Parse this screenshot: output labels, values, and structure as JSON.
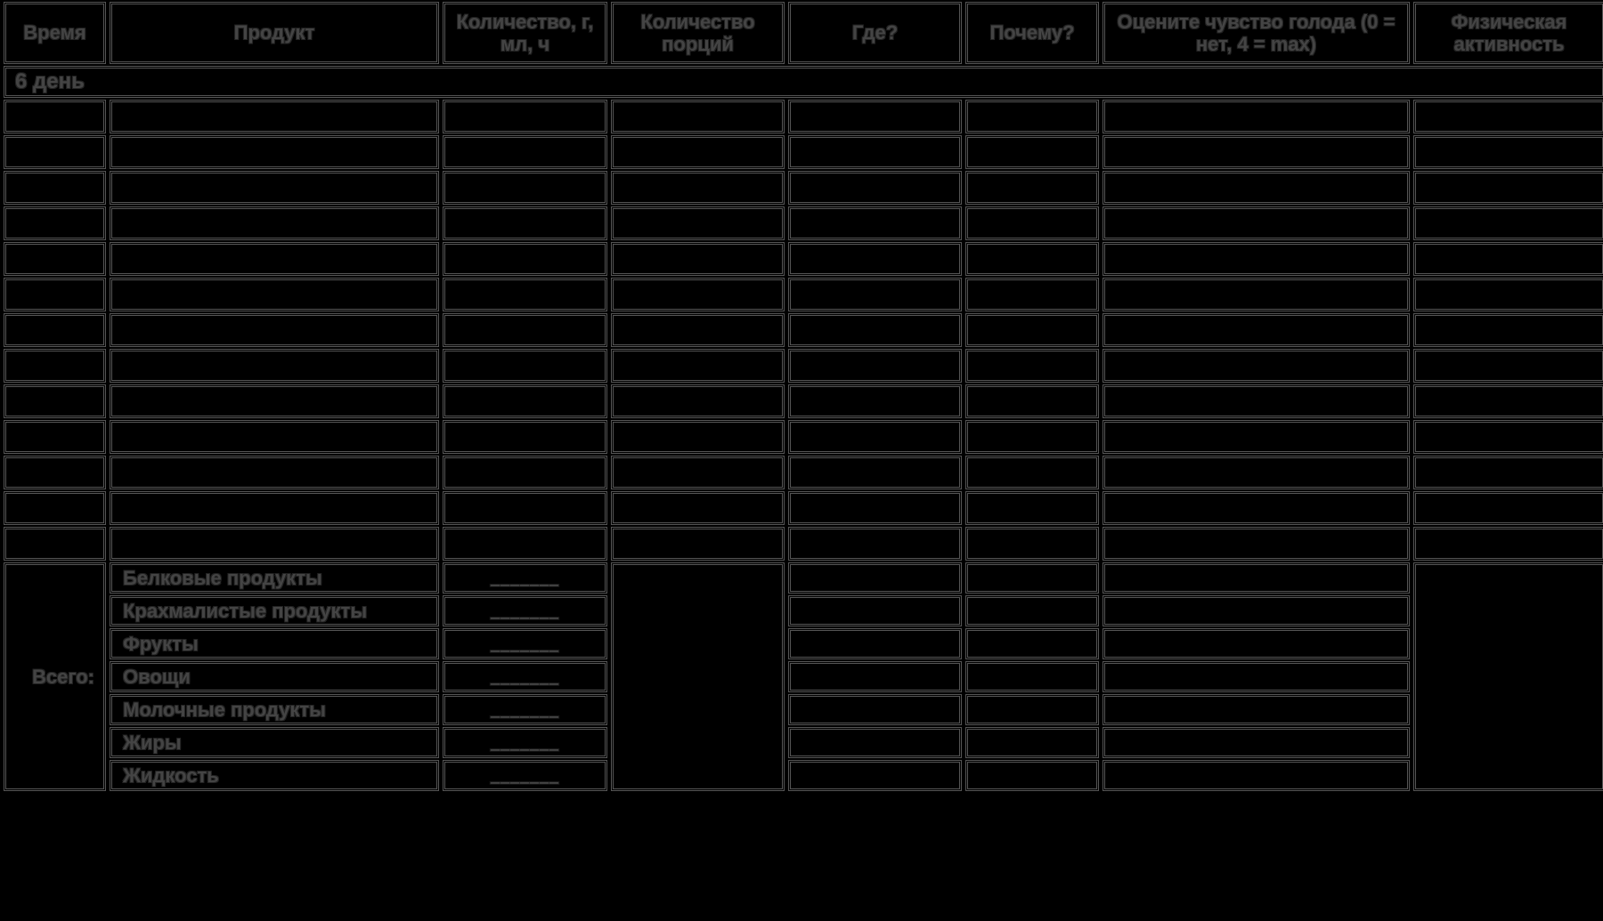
{
  "headers": {
    "time": "Время",
    "product": "Продукт",
    "quantity": "Количество,\nг, мл, ч",
    "portions": "Количество\nпорций",
    "where": "Где?",
    "why": "Почему?",
    "hunger": "Оцените чувство голода\n(0 = нет, 4 = max)",
    "activity": "Физическая\nактивность"
  },
  "day_label": "6 день",
  "data_row_count": 13,
  "totals": {
    "label": "Всего:",
    "blank_placeholder": "_______",
    "categories": [
      "Белковые продукты",
      "Крахмалистые продукты",
      "Фрукты",
      "Овощи",
      "Молочные продукты",
      "Жиры",
      "Жидкость"
    ]
  }
}
